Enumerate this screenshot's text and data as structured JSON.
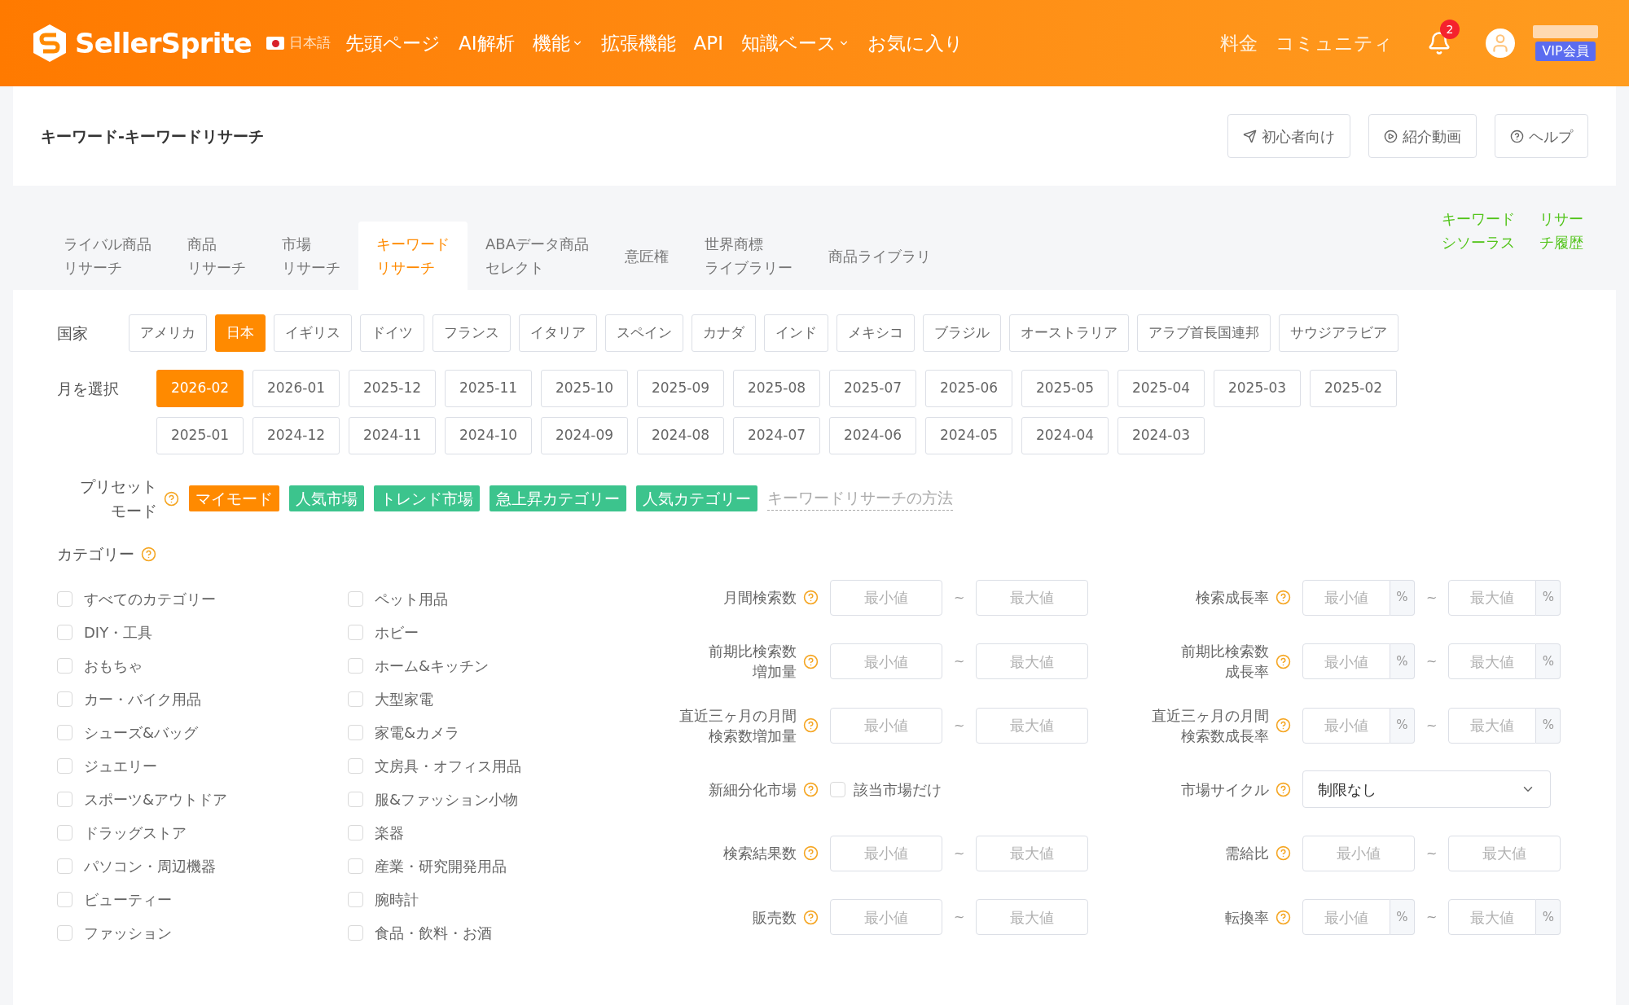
{
  "header": {
    "logo": "SellerSprite",
    "language": "日本語",
    "nav": [
      {
        "label": "先頭ページ",
        "dropdown": false
      },
      {
        "label": "AI解析",
        "dropdown": false
      },
      {
        "label": "機能",
        "dropdown": true
      },
      {
        "label": "拡張機能",
        "dropdown": false
      },
      {
        "label": "API",
        "dropdown": false
      },
      {
        "label": "知識ベース",
        "dropdown": true
      },
      {
        "label": "お気に入り",
        "dropdown": false
      }
    ],
    "right_links": [
      "料金",
      "コミュニティ"
    ],
    "notification_count": "2",
    "badge": "VIP会員"
  },
  "page": {
    "title": "キーワード-キーワードリサーチ",
    "buttons": [
      {
        "label": "初心者向け",
        "kind": "guide"
      },
      {
        "label": "紹介動画",
        "kind": "video"
      },
      {
        "label": "ヘルプ",
        "kind": "help"
      }
    ]
  },
  "tabs": [
    {
      "lines": [
        "ライバル商品",
        "リサーチ"
      ],
      "selected": false
    },
    {
      "lines": [
        "商品",
        "リサーチ"
      ],
      "selected": false
    },
    {
      "lines": [
        "市場",
        "リサーチ"
      ],
      "selected": false
    },
    {
      "lines": [
        "キーワード",
        "リサーチ"
      ],
      "selected": true
    },
    {
      "lines": [
        "ABAデータ商品",
        "セレクト"
      ],
      "selected": false
    },
    {
      "lines": [
        "意匠権"
      ],
      "selected": false
    },
    {
      "lines": [
        "世界商標",
        "ライブラリー"
      ],
      "selected": false
    },
    {
      "lines": [
        "商品ライブラリ"
      ],
      "selected": false
    }
  ],
  "side_links": [
    {
      "lines": [
        "キーワード",
        "シソーラス"
      ]
    },
    {
      "lines": [
        "リサー",
        "チ履歴"
      ]
    }
  ],
  "country": {
    "label": "国家",
    "options": [
      {
        "label": "アメリカ",
        "selected": false
      },
      {
        "label": "日本",
        "selected": true
      },
      {
        "label": "イギリス",
        "selected": false
      },
      {
        "label": "ドイツ",
        "selected": false
      },
      {
        "label": "フランス",
        "selected": false
      },
      {
        "label": "イタリア",
        "selected": false
      },
      {
        "label": "スペイン",
        "selected": false
      },
      {
        "label": "カナダ",
        "selected": false
      },
      {
        "label": "インド",
        "selected": false
      },
      {
        "label": "メキシコ",
        "selected": false
      },
      {
        "label": "ブラジル",
        "selected": false
      },
      {
        "label": "オーストラリア",
        "selected": false
      },
      {
        "label": "アラブ首長国連邦",
        "selected": false
      },
      {
        "label": "サウジアラビア",
        "selected": false
      }
    ]
  },
  "month": {
    "label": "月を選択",
    "options": [
      {
        "label": "2026-02",
        "selected": true
      },
      {
        "label": "2026-01",
        "selected": false
      },
      {
        "label": "2025-12",
        "selected": false
      },
      {
        "label": "2025-11",
        "selected": false
      },
      {
        "label": "2025-10",
        "selected": false
      },
      {
        "label": "2025-09",
        "selected": false
      },
      {
        "label": "2025-08",
        "selected": false
      },
      {
        "label": "2025-07",
        "selected": false
      },
      {
        "label": "2025-06",
        "selected": false
      },
      {
        "label": "2025-05",
        "selected": false
      },
      {
        "label": "2025-04",
        "selected": false
      },
      {
        "label": "2025-03",
        "selected": false
      },
      {
        "label": "2025-02",
        "selected": false
      },
      {
        "label": "2025-01",
        "selected": false
      },
      {
        "label": "2024-12",
        "selected": false
      },
      {
        "label": "2024-11",
        "selected": false
      },
      {
        "label": "2024-10",
        "selected": false
      },
      {
        "label": "2024-09",
        "selected": false
      },
      {
        "label": "2024-08",
        "selected": false
      },
      {
        "label": "2024-07",
        "selected": false
      },
      {
        "label": "2024-06",
        "selected": false
      },
      {
        "label": "2024-05",
        "selected": false
      },
      {
        "label": "2024-04",
        "selected": false
      },
      {
        "label": "2024-03",
        "selected": false
      }
    ]
  },
  "preset": {
    "lines": [
      "プリセット",
      "モード"
    ],
    "options": [
      {
        "label": "マイモード",
        "selected": true
      },
      {
        "label": "人気市場",
        "selected": false
      },
      {
        "label": "トレンド市場",
        "selected": false
      },
      {
        "label": "急上昇カテゴリー",
        "selected": false
      },
      {
        "label": "人気カテゴリー",
        "selected": false
      }
    ],
    "link": "キーワードリサーチの方法"
  },
  "category": {
    "label": "カテゴリー",
    "items": [
      {
        "label": "すべてのカテゴリー",
        "checked": false
      },
      {
        "label": "DIY・工具",
        "checked": false
      },
      {
        "label": "おもちゃ",
        "checked": false
      },
      {
        "label": "カー・バイク用品",
        "checked": false
      },
      {
        "label": "シューズ&バッグ",
        "checked": false
      },
      {
        "label": "ジュエリー",
        "checked": false
      },
      {
        "label": "スポーツ&アウトドア",
        "checked": false
      },
      {
        "label": "ドラッグストア",
        "checked": false
      },
      {
        "label": "パソコン・周辺機器",
        "checked": false
      },
      {
        "label": "ビューティー",
        "checked": false
      },
      {
        "label": "ファッション",
        "checked": false
      },
      {
        "label": "ペット用品",
        "checked": false
      },
      {
        "label": "ホビー",
        "checked": false
      },
      {
        "label": "ホーム&キッチン",
        "checked": false
      },
      {
        "label": "大型家電",
        "checked": false
      },
      {
        "label": "家電&カメラ",
        "checked": false
      },
      {
        "label": "文房具・オフィス用品",
        "checked": false
      },
      {
        "label": "服&ファッション小物",
        "checked": false
      },
      {
        "label": "楽器",
        "checked": false
      },
      {
        "label": "産業・研究開発用品",
        "checked": false
      },
      {
        "label": "腕時計",
        "checked": false
      },
      {
        "label": "食品・飲料・お酒",
        "checked": false
      }
    ]
  },
  "filters": [
    {
      "kind": "range",
      "lines": [
        "月間検索数"
      ],
      "min_placeholder": "最小値",
      "max_placeholder": "最大値",
      "separator": "~"
    },
    {
      "kind": "range_pct",
      "lines": [
        "検索成長率"
      ],
      "min_placeholder": "最小値",
      "max_placeholder": "最大値",
      "separator": "~",
      "unit": "%"
    },
    {
      "kind": "range",
      "lines": [
        "前期比検索数",
        "増加量"
      ],
      "min_placeholder": "最小値",
      "max_placeholder": "最大値",
      "separator": "~"
    },
    {
      "kind": "range_pct",
      "lines": [
        "前期比検索数",
        "成長率"
      ],
      "min_placeholder": "最小値",
      "max_placeholder": "最大値",
      "separator": "~",
      "unit": "%"
    },
    {
      "kind": "range",
      "lines": [
        "直近三ヶ月の月間",
        "検索数増加量"
      ],
      "min_placeholder": "最小値",
      "max_placeholder": "最大値",
      "separator": "~"
    },
    {
      "kind": "range_pct",
      "lines": [
        "直近三ヶ月の月間",
        "検索数成長率"
      ],
      "min_placeholder": "最小値",
      "max_placeholder": "最大値",
      "separator": "~",
      "unit": "%"
    },
    {
      "kind": "checkbox",
      "lines": [
        "新細分化市場"
      ],
      "option": "該当市場だけ",
      "checked": false
    },
    {
      "kind": "select",
      "lines": [
        "市場サイクル"
      ],
      "value": "制限なし"
    },
    {
      "kind": "range",
      "lines": [
        "検索結果数"
      ],
      "min_placeholder": "最小値",
      "max_placeholder": "最大値",
      "separator": "~"
    },
    {
      "kind": "range",
      "lines": [
        "需給比"
      ],
      "min_placeholder": "最小値",
      "max_placeholder": "最大値",
      "separator": "~"
    },
    {
      "kind": "range",
      "lines": [
        "販売数"
      ],
      "min_placeholder": "最小値",
      "max_placeholder": "最大値",
      "separator": "~"
    },
    {
      "kind": "range_pct",
      "lines": [
        "転換率"
      ],
      "min_placeholder": "最小値",
      "max_placeholder": "最大値",
      "separator": "~",
      "unit": "%"
    }
  ]
}
